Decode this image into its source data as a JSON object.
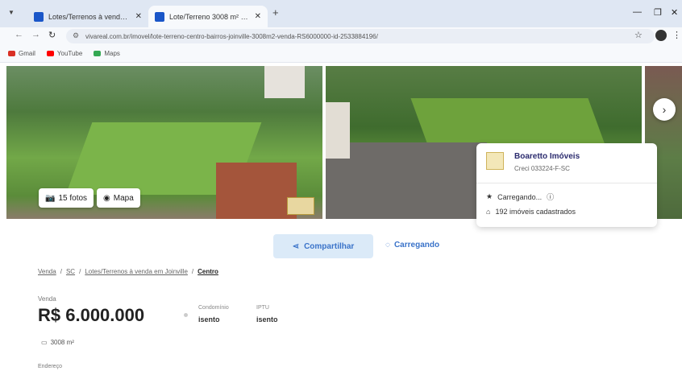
{
  "browser": {
    "tabs": [
      {
        "title": "Lotes/Terrenos à venda em Joi",
        "active": false
      },
      {
        "title": "Lote/Terreno 3008 m² em Cent",
        "active": true
      }
    ],
    "url": "vivareal.com.br/imovel/lote-terreno-centro-bairros-joinville-3008m2-venda-RS6000000-id-2533884196/",
    "bookmarks": [
      {
        "label": "Gmail",
        "color": "#d93025"
      },
      {
        "label": "YouTube",
        "color": "#ff0000"
      },
      {
        "label": "Maps",
        "color": "#34a853"
      }
    ]
  },
  "gallery": {
    "photos_label": "15 fotos",
    "map_label": "Mapa"
  },
  "agent": {
    "name": "Boaretto Imóveis",
    "creci": "Creci 033224-F-SC",
    "status": "Carregando...",
    "listings": "192 imóveis cadastrados"
  },
  "actions": {
    "share_label": "Compartilhar",
    "loading_label": "Carregando"
  },
  "breadcrumb": [
    "Venda",
    "SC",
    "Lotes/Terrenos à venda em Joinville",
    "Centro"
  ],
  "listing": {
    "sale_label": "Venda",
    "price": "R$ 6.000.000",
    "condo_label": "Condomínio",
    "condo_value": "isento",
    "iptu_label": "IPTU",
    "iptu_value": "isento",
    "area": "3008 m²",
    "address_label": "Endereço"
  },
  "colors": {
    "accent": "#3a73c9",
    "share_bg": "#dbeaf8"
  }
}
